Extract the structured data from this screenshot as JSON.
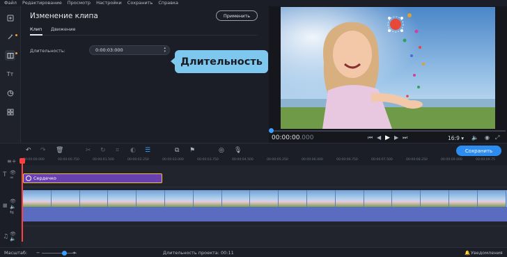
{
  "menu": [
    "Файл",
    "Редактирование",
    "Просмотр",
    "Настройки",
    "Сохранить",
    "Справка"
  ],
  "panel": {
    "title": "Изменение клипа",
    "apply_label": "Применить",
    "tabs": [
      "Клип",
      "Движение"
    ],
    "duration_label": "Длительность:",
    "duration_value": "0:00:03:000"
  },
  "callout": "Длительность",
  "preview": {
    "timecode": "00:00:00",
    "timecode_ms": ".000",
    "aspect_ratio": "16:9"
  },
  "timeline": {
    "save_label": "Сохранить",
    "ruler": [
      "00:00:00.000",
      "00:00:00.750",
      "00:00:01.500",
      "00:00:02.250",
      "00:00:03.000",
      "00:00:03.750",
      "00:00:04.500",
      "00:00:05.250",
      "00:00:06.000",
      "00:00:06.750",
      "00:00:07.500",
      "00:00:08.250",
      "00:00:09.000",
      "00:00:09.75"
    ],
    "title_clip": "Сердечко"
  },
  "status": {
    "zoom_label": "Масштаб:",
    "project_duration": "Длительность проекта: 00:11",
    "notifications": "Уведомления"
  },
  "colors": {
    "accent": "#2d8cf0",
    "callout": "#7ec8ef",
    "title_clip": "#6a40b0",
    "playhead": "#ff4040"
  }
}
